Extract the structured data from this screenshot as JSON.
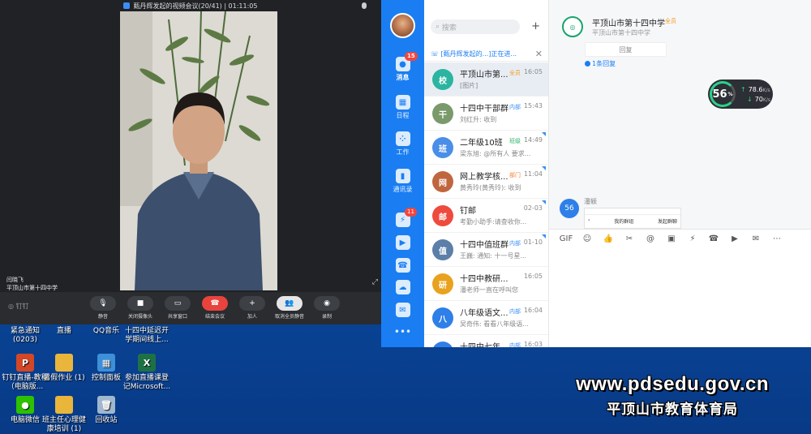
{
  "desktop": {
    "watermark": {
      "url": "www.pdsedu.gov.cn",
      "org": "平顶山市教育体育局"
    },
    "icons": [
      {
        "label": "紧急通知(0203)",
        "icon": "document-icon",
        "color": "#2f6fd6"
      },
      {
        "label": "直播",
        "icon": "folder-icon",
        "color": "#e9b53b"
      },
      {
        "label": "QQ音乐",
        "icon": "music-icon",
        "color": "#31c27c"
      },
      {
        "label": "十四中延迟开学期间线上...",
        "icon": "document-icon",
        "color": "#2f6fd6"
      },
      {
        "label": "钉钉直播-教程（电脑版...",
        "icon": "ppt-icon",
        "color": "#d24726"
      },
      {
        "label": "暑假作业 (1)",
        "icon": "folder-icon",
        "color": "#e9b53b"
      },
      {
        "label": "控制面板",
        "icon": "control-panel-icon",
        "color": "#3d8fd8"
      },
      {
        "label": "参加直播课登记Microsoft...",
        "icon": "excel-icon",
        "color": "#1e7145"
      },
      {
        "label": "电脑微信",
        "icon": "wechat-icon",
        "color": "#2dc100"
      },
      {
        "label": "班主任心理健康培训 (1)",
        "icon": "folder-icon",
        "color": "#e9b53b"
      },
      {
        "label": "回收站",
        "icon": "recycle-bin-icon",
        "color": "#9fb7cf"
      }
    ]
  },
  "meeting": {
    "title": "甄丹辉发起的视频会议(20/41) | 01:11:05",
    "participant_name": "闫晓飞",
    "participant_org": "平顶山市第十四中学",
    "brand": "钉钉",
    "controls": [
      {
        "label": "静音",
        "icon": "mic-icon"
      },
      {
        "label": "关闭摄像头",
        "icon": "camera-icon"
      },
      {
        "label": "共享窗口",
        "icon": "screen-share-icon"
      },
      {
        "label": "结束会议",
        "icon": "hangup-icon"
      },
      {
        "label": "加人",
        "icon": "add-person-icon"
      },
      {
        "label": "取消全员静音",
        "icon": "people-icon"
      },
      {
        "label": "录制",
        "icon": "record-icon"
      }
    ]
  },
  "dingtalk": {
    "accent": "#1a7ef2",
    "rail": [
      {
        "label": "消息",
        "icon": "message-icon",
        "badge": "15"
      },
      {
        "label": "日程",
        "icon": "calendar-icon",
        "badge": ""
      },
      {
        "label": "工作",
        "icon": "apps-icon",
        "badge": ""
      },
      {
        "label": "通讯录",
        "icon": "contacts-icon",
        "badge": ""
      },
      {
        "label": "",
        "icon": "ding-icon",
        "badge": "11"
      },
      {
        "label": "",
        "icon": "video-icon",
        "badge": ""
      },
      {
        "label": "",
        "icon": "phone-icon",
        "badge": ""
      },
      {
        "label": "",
        "icon": "cloud-icon",
        "badge": ""
      },
      {
        "label": "",
        "icon": "mail-icon",
        "badge": ""
      },
      {
        "label": "",
        "icon": "more-icon",
        "badge": ""
      }
    ],
    "search_placeholder": "搜索",
    "banner": "[甄丹辉发起的...]正在进...",
    "conversations": [
      {
        "name": "平顶山市第...",
        "tag": "全员",
        "tag_color": "#f39a1d",
        "time": "16:05",
        "snippet": "[图片]",
        "avatar_color": "#2bb5a0",
        "avatar": "校"
      },
      {
        "name": "十四中干部群",
        "tag": "内部",
        "tag_color": "#3a8ff5",
        "time": "15:43",
        "snippet": "刘红升: 收到",
        "avatar_color": "#7a9a6b",
        "avatar": "干"
      },
      {
        "name": "二年级10班",
        "tag": "班级",
        "tag_color": "#2cb36b",
        "time": "14:49",
        "snippet": "梁东旭: @所有人 要求...",
        "avatar_color": "#4a8ee8",
        "avatar": "班"
      },
      {
        "name": "网上教学核...",
        "tag": "部门",
        "tag_color": "#f3803a",
        "time": "11:04",
        "snippet": "黄秀玲(黄秀玲): 收到",
        "avatar_color": "#c0663f",
        "avatar": "网"
      },
      {
        "name": "钉邮",
        "tag": "",
        "tag_color": "#3a8ff5",
        "time": "02-03",
        "snippet": "考勤小助手:请查收你...",
        "avatar_color": "#ee4a3d",
        "avatar": "邮"
      },
      {
        "name": "十四中值班群",
        "tag": "内部",
        "tag_color": "#3a8ff5",
        "time": "01-10",
        "snippet": "王巍: 通知: 十一号星...",
        "avatar_color": "#5b7fa8",
        "avatar": "值"
      },
      {
        "name": "十四中教研...",
        "tag": "",
        "tag_color": "#3a8ff5",
        "time": "16:05",
        "snippet": "潘老师一直在呼叫您",
        "avatar_color": "#e9a21d",
        "avatar": "研"
      },
      {
        "name": "八年级语文...",
        "tag": "内部",
        "tag_color": "#3a8ff5",
        "time": "16:04",
        "snippet": "吴奇伟: 看看八年级语...",
        "avatar_color": "#2e7fe8",
        "avatar": "八"
      },
      {
        "name": "十四中七年...",
        "tag": "内部",
        "tag_color": "#3a8ff5",
        "time": "16:03",
        "snippet": "",
        "avatar_color": "#2e7fe8",
        "avatar": "七"
      }
    ],
    "chat": {
      "title": "平顶山市第十四中学",
      "title_tag": "全员",
      "subtitle": "平顶山市第十四中学",
      "reply_button": "回复",
      "reply_count": "1条回复",
      "net_widget": {
        "percent": "56",
        "unit": "%",
        "up": "78.6",
        "down": "70",
        "speed_unit": "K/s"
      },
      "message": {
        "avatar": "56",
        "sender": "潘颖",
        "shot_left": "我的群组",
        "shot_right": "发起群聊"
      },
      "toolbar": [
        "GIF",
        "☺",
        "👍",
        "✂",
        "@",
        "▣",
        "⚡",
        "☎",
        "▶",
        "✉",
        "⋯"
      ]
    }
  }
}
